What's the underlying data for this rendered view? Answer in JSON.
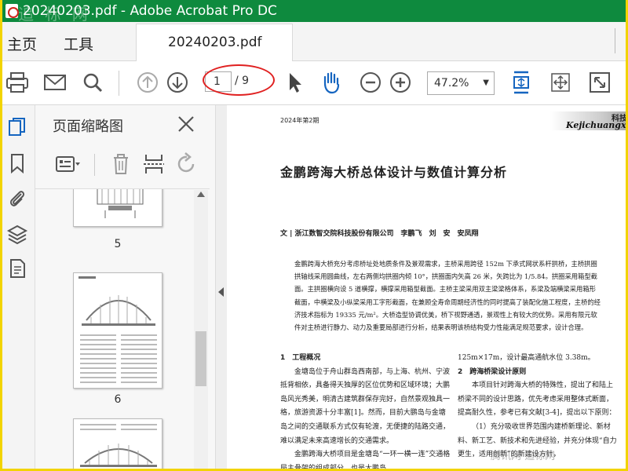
{
  "window": {
    "title": "20240203.pdf - Adobe Acrobat Pro DC",
    "watermark": "追 标 网"
  },
  "menu": {
    "home": "主页",
    "tools": "工具",
    "tab_label": "20240203.pdf"
  },
  "toolbar": {
    "page_current": "1",
    "page_total": "/ 9",
    "zoom": "47.2%"
  },
  "thumbnails": {
    "title": "页面缩略图",
    "labels": [
      "5",
      "6"
    ]
  },
  "document": {
    "issue": "2024年第2期",
    "banner_text": "Kejichuangx",
    "banner_zh": "科技创",
    "title": "金鹏跨海大桥总体设计与数值计算分析",
    "authors": "文 | 浙江数智交院科技股份有限公司　李鹏飞　刘　安　安凤翔",
    "abstract": "金鹏跨海大桥充分考虑桥址处地质条件及景观需求，主桥采用跨径 152m 下承式网状系杆拱桥，主桥拱圈拱轴线采用圆曲线，左右两侧均拱圈内倾 10°，拱圈面内矢高 26 米，矢跨比为 1/5.84。拱圈采用箱型截面。主拱圈横向设 5 道横撑，横撑采用箱型截面。主桥主梁采用双主梁梁格体系，系梁及端横梁采用箱形截面，中横梁及小纵梁采用工字形截面，在兼顾全寿命周期经济性的同时提高了装配化施工程度，主桥的经济技术指标为 19335 元/m²。大桥造型协调优美，桥下视野通透，景观性上有较大的优势。采用有限元软件对主桥进行静力、动力及重要局部进行分析，结果表明该桥结构受力性能满足规范要求，设计合理。",
    "col1_heading": "1　工程概况",
    "col1_text": "金塘岛位于舟山群岛西南部，与上海、杭州、宁波抵背相依，具备得天独厚的区位优势和区域环境；大鹏岛风光秀美，明清古建筑群保存完好，自然景观独具一格，旅游资源十分丰富[1]。然而，目前大鹏岛与金塘岛之间的交通联系方式仅有轮渡，无便捷的陆路交通，难以满足未来高速增长的交通需求。",
    "col1_text2": "金鹏跨海大桥项目是金塘岛“一环一横一连”交通格局主骨架的组成部分，也是大鹏岛",
    "col2_line1": "125m×17m，设计最高通航水位 3.38m。",
    "col2_heading": "2　跨海桥梁设计原则",
    "col2_text": "本项目针对跨海大桥的特殊性，提出了和陆上桥梁不同的设计思路，优先考虑采用整体式断面，提高耐久性，参考已有文献[3-4]，提出以下原则：",
    "col2_text2": "（1）充分吸收世界范围内建桥新理论、新材料、新工艺、新技术和先进经验，并充分体现“自力更生，适用创新”的新建设方针，",
    "wm2": "腾讯网 追标网"
  }
}
